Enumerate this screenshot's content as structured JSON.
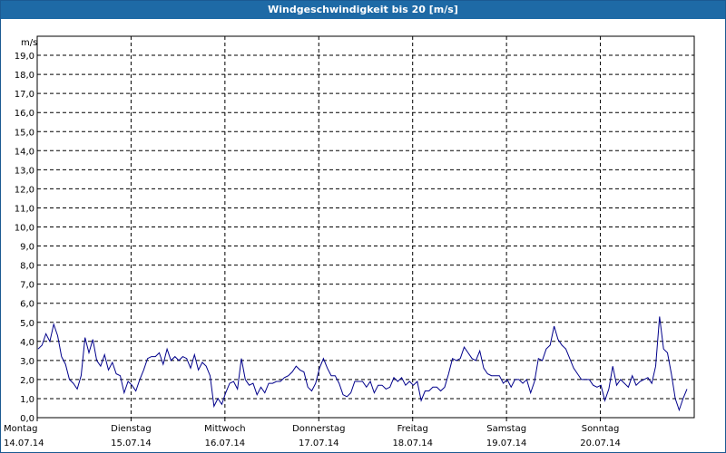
{
  "window": {
    "title": "Windgeschwindigkeit bis 20 [m/s]"
  },
  "colors": {
    "titlebar": "#1e6aa6",
    "series": "#00008b",
    "grid": "#000000"
  },
  "chart_data": {
    "type": "line",
    "title": "Windgeschwindigkeit bis 20 [m/s]",
    "ylabel": "m/s",
    "ylim": [
      0,
      20
    ],
    "y_ticks": [
      "0,0",
      "1,0",
      "2,0",
      "3,0",
      "4,0",
      "5,0",
      "6,0",
      "7,0",
      "8,0",
      "9,0",
      "10,0",
      "11,0",
      "12,0",
      "13,0",
      "14,0",
      "15,0",
      "16,0",
      "17,0",
      "18,0",
      "19,0"
    ],
    "grid": true,
    "x_ticks": [
      {
        "day": "Montag",
        "date": "14.07.14"
      },
      {
        "day": "Dienstag",
        "date": "15.07.14"
      },
      {
        "day": "Mittwoch",
        "date": "16.07.14"
      },
      {
        "day": "Donnerstag",
        "date": "17.07.14"
      },
      {
        "day": "Freitag",
        "date": "18.07.14"
      },
      {
        "day": "Samstag",
        "date": "19.07.14"
      },
      {
        "day": "Sonntag",
        "date": "20.07.14"
      }
    ],
    "series": [
      {
        "values": [
          3.6,
          3.8,
          4.4,
          4.0,
          4.9,
          4.3,
          3.2,
          2.8,
          2.0,
          1.8,
          1.5,
          2.2,
          4.2,
          3.4,
          4.1,
          3.0,
          2.7,
          3.3,
          2.5,
          2.9,
          2.3,
          2.2,
          1.3,
          1.9,
          1.7,
          1.4,
          2.0,
          2.5,
          3.1,
          3.2,
          3.2,
          3.4,
          2.8,
          3.6,
          3.0,
          3.2,
          3.0,
          3.2,
          3.1,
          2.6,
          3.3,
          2.5,
          2.9,
          2.7,
          2.2,
          0.6,
          1.0,
          0.7,
          1.3,
          1.8,
          1.9,
          1.5,
          3.1,
          2.0,
          1.7,
          1.8,
          1.2,
          1.6,
          1.3,
          1.8,
          1.8,
          1.9,
          1.9,
          2.1,
          2.2,
          2.4,
          2.7,
          2.5,
          2.4,
          1.6,
          1.4,
          1.8,
          2.6,
          3.1,
          2.6,
          2.2,
          2.2,
          1.8,
          1.2,
          1.1,
          1.3,
          1.9,
          1.9,
          1.9,
          1.6,
          1.9,
          1.3,
          1.7,
          1.7,
          1.5,
          1.6,
          2.1,
          1.9,
          2.1,
          1.7,
          1.9,
          1.7,
          1.9,
          0.9,
          1.4,
          1.4,
          1.6,
          1.6,
          1.4,
          1.6,
          2.3,
          3.1,
          3.0,
          3.1,
          3.7,
          3.4,
          3.1,
          3.0,
          3.5,
          2.6,
          2.3,
          2.2,
          2.2,
          2.2,
          1.8,
          2.0,
          1.6,
          2.0,
          2.0,
          1.8,
          2.0,
          1.3,
          1.9,
          3.1,
          3.0,
          3.6,
          3.8,
          4.8,
          4.1,
          3.8,
          3.6,
          3.1,
          2.6,
          2.3,
          2.0,
          2.0,
          2.0,
          1.7,
          1.6,
          1.7,
          0.9,
          1.5,
          2.7,
          1.7,
          2.0,
          1.8,
          1.6,
          2.2,
          1.7,
          1.9,
          2.0,
          2.1,
          1.8,
          2.7,
          5.3,
          3.6,
          3.4,
          2.3,
          1.0,
          0.4,
          1.0,
          1.5
        ]
      }
    ]
  }
}
